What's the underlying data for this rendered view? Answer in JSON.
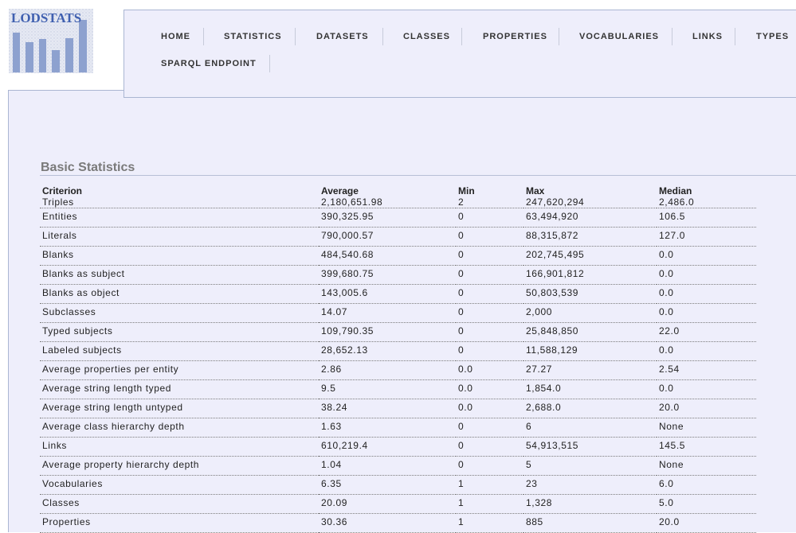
{
  "logo": {
    "text": "LODSTATS"
  },
  "nav": [
    {
      "label": "HOME"
    },
    {
      "label": "STATISTICS"
    },
    {
      "label": "DATASETS"
    },
    {
      "label": "CLASSES"
    },
    {
      "label": "PROPERTIES"
    },
    {
      "label": "VOCABULARIES"
    },
    {
      "label": "LINKS"
    },
    {
      "label": "TYPES"
    },
    {
      "label": "SPARQL ENDPOINT"
    }
  ],
  "section_title": "Basic Statistics",
  "table": {
    "headers": [
      "Criterion",
      "Average",
      "Min",
      "Max",
      "Median"
    ],
    "rows": [
      [
        "Triples",
        "2,180,651.98",
        "2",
        "247,620,294",
        "2,486.0"
      ],
      [
        "Entities",
        "390,325.95",
        "0",
        "63,494,920",
        "106.5"
      ],
      [
        "Literals",
        "790,000.57",
        "0",
        "88,315,872",
        "127.0"
      ],
      [
        "Blanks",
        "484,540.68",
        "0",
        "202,745,495",
        "0.0"
      ],
      [
        "Blanks as subject",
        "399,680.75",
        "0",
        "166,901,812",
        "0.0"
      ],
      [
        "Blanks as object",
        "143,005.6",
        "0",
        "50,803,539",
        "0.0"
      ],
      [
        "Subclasses",
        "14.07",
        "0",
        "2,000",
        "0.0"
      ],
      [
        "Typed subjects",
        "109,790.35",
        "0",
        "25,848,850",
        "22.0"
      ],
      [
        "Labeled subjects",
        "28,652.13",
        "0",
        "11,588,129",
        "0.0"
      ],
      [
        "Average properties per entity",
        "2.86",
        "0.0",
        "27.27",
        "2.54"
      ],
      [
        "Average string length typed",
        "9.5",
        "0.0",
        "1,854.0",
        "0.0"
      ],
      [
        "Average string length untyped",
        "38.24",
        "0.0",
        "2,688.0",
        "20.0"
      ],
      [
        "Average class hierarchy depth",
        "1.63",
        "0",
        "6",
        "None"
      ],
      [
        "Links",
        "610,219.4",
        "0",
        "54,913,515",
        "145.5"
      ],
      [
        "Average property hierarchy depth",
        "1.04",
        "0",
        "5",
        "None"
      ],
      [
        "Vocabularies",
        "6.35",
        "1",
        "23",
        "6.0"
      ],
      [
        "Classes",
        "20.09",
        "1",
        "1,328",
        "5.0"
      ],
      [
        "Properties",
        "30.36",
        "1",
        "885",
        "20.0"
      ]
    ]
  }
}
